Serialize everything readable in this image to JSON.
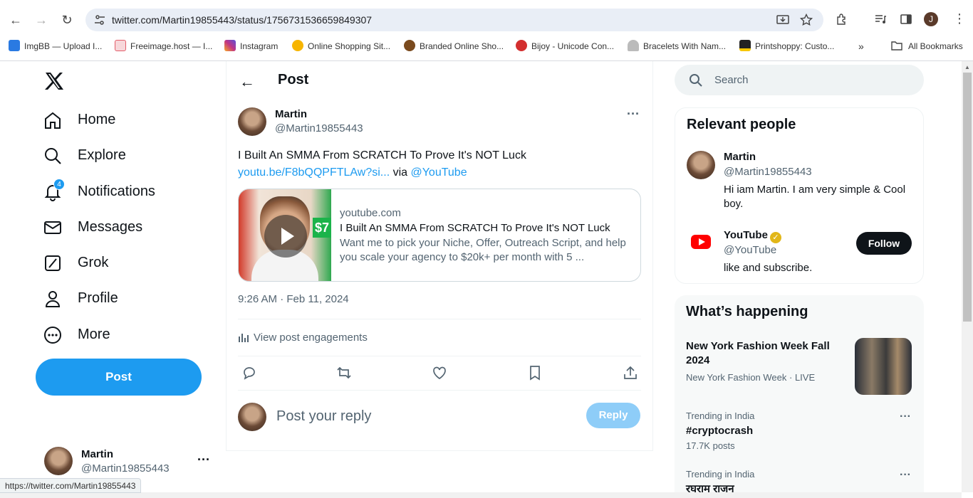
{
  "browser": {
    "url": "twitter.com/Martin19855443/status/1756731536659849307",
    "bookmarks": [
      {
        "label": "ImgBB — Upload I...",
        "color": "#2a7ae2"
      },
      {
        "label": "Freeimage.host — I...",
        "color": "#e35d6a"
      },
      {
        "label": "Instagram",
        "color": "#c13584"
      },
      {
        "label": "Online Shopping Sit...",
        "color": "#f7b500"
      },
      {
        "label": "Branded Online Sho...",
        "color": "#7a4a1e"
      },
      {
        "label": "Bijoy - Unicode Con...",
        "color": "#d32f2f"
      },
      {
        "label": "Bracelets With Nam...",
        "color": "#888888"
      },
      {
        "label": "Printshoppy: Custo...",
        "color": "#222222"
      }
    ],
    "all_bookmarks": "All Bookmarks",
    "profile_initial": "J",
    "status_url": "https://twitter.com/Martin19855443"
  },
  "nav": {
    "items": [
      {
        "label": "Home",
        "icon": "home-icon"
      },
      {
        "label": "Explore",
        "icon": "search-icon"
      },
      {
        "label": "Notifications",
        "icon": "bell-icon",
        "badge": "4"
      },
      {
        "label": "Messages",
        "icon": "envelope-icon"
      },
      {
        "label": "Grok",
        "icon": "grok-icon"
      },
      {
        "label": "Profile",
        "icon": "person-icon"
      },
      {
        "label": "More",
        "icon": "more-circle-icon"
      }
    ],
    "post_button": "Post",
    "account": {
      "name": "Martin",
      "handle": "@Martin19855443"
    }
  },
  "post": {
    "header": "Post",
    "author": {
      "name": "Martin",
      "handle": "@Martin19855443"
    },
    "text_line1": "I Built An SMMA From SCRATCH To Prove It's NOT Luck",
    "link": "youtu.be/F8bQQPFTLAw?si...",
    "via": " via ",
    "mention": "@YouTube",
    "card": {
      "domain": "youtube.com",
      "title": "I Built An SMMA From SCRATCH To Prove It's NOT Luck",
      "description": "Want me to pick your Niche, Offer, Outreach Script, and help you scale your agency to $20k+ per month with 5 ...",
      "thumb_badge": "$7"
    },
    "timestamp": "9:26 AM · Feb 11, 2024",
    "engagements": "View post engagements",
    "reply_placeholder": "Post your reply",
    "reply_button": "Reply"
  },
  "sidebar": {
    "search_placeholder": "Search",
    "relevant": {
      "title": "Relevant people",
      "people": [
        {
          "name": "Martin",
          "handle": "@Martin19855443",
          "bio": "Hi iam Martin. I am very simple & Cool boy."
        },
        {
          "name": "YouTube",
          "handle": "@YouTube",
          "bio": "like and subscribe.",
          "follow": "Follow"
        }
      ]
    },
    "happening": {
      "title": "What’s happening",
      "items": [
        {
          "title": "New York Fashion Week Fall 2024",
          "meta": "New York Fashion Week · LIVE"
        },
        {
          "meta": "Trending in India",
          "title": "#cryptocrash",
          "count": "17.7K posts"
        },
        {
          "meta": "Trending in India",
          "title": "रघराम राजन"
        }
      ]
    }
  },
  "colors": {
    "accent": "#1d9bf0",
    "text": "#0f1419",
    "muted": "#536471"
  }
}
